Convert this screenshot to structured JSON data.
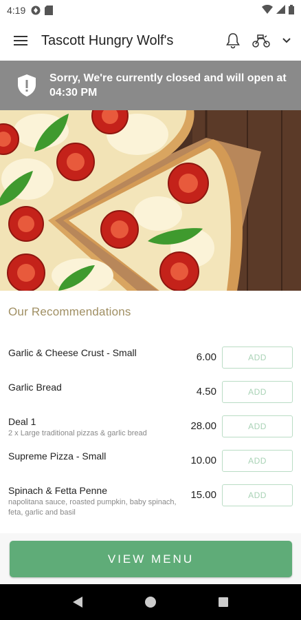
{
  "status_bar": {
    "time": "4:19"
  },
  "app_bar": {
    "title": "Tascott Hungry Wolf's"
  },
  "banner": {
    "message": "Sorry, We're currently closed and will open at 04:30 PM"
  },
  "recommendations": {
    "title": "Our Recommendations",
    "add_label": "ADD",
    "items": [
      {
        "name": "Garlic & Cheese Crust - Small",
        "description": "",
        "price": "6.00"
      },
      {
        "name": "Garlic Bread",
        "description": "",
        "price": "4.50"
      },
      {
        "name": "Deal 1",
        "description": "2 x Large traditional pizzas & garlic bread",
        "price": "28.00"
      },
      {
        "name": "Supreme Pizza - Small",
        "description": "",
        "price": "10.00"
      },
      {
        "name": "Spinach & Fetta Penne",
        "description": "napolitana sauce, roasted pumpkin, baby spinach, feta, garlic and basil",
        "price": "15.00"
      }
    ]
  },
  "footer": {
    "view_menu_label": "VIEW MENU"
  },
  "colors": {
    "accent": "#5fac78",
    "banner": "#8a8a8a",
    "section_title": "#a08f63"
  }
}
